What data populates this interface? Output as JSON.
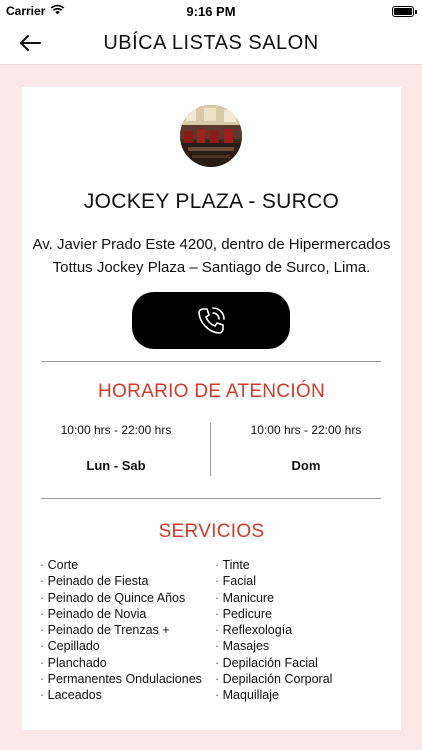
{
  "status_bar": {
    "carrier": "Carrier",
    "time": "9:16 PM"
  },
  "nav": {
    "title": "UBÍCA LISTAS SALON",
    "back_icon": "arrow-left-icon"
  },
  "store": {
    "name": "JOCKEY PLAZA - SURCO",
    "address_line1": "Av. Javier Prado Este 4200, dentro de Hipermercados",
    "address_line2": "Tottus Jockey Plaza – Santiago de Surco, Lima.",
    "call_icon": "phone-call-icon"
  },
  "hours": {
    "title": "HORARIO DE ATENCIÓN",
    "columns": [
      {
        "time": "10:00 hrs - 22:00 hrs",
        "days": "Lun - Sab"
      },
      {
        "time": "10:00 hrs - 22:00 hrs",
        "days": "Dom"
      }
    ]
  },
  "services": {
    "title": "SERVICIOS",
    "left": [
      "Corte",
      "Peinado de Fiesta",
      "Peinado de Quince Años",
      "Peinado de Novia",
      "Peinado de Trenzas +",
      "Cepillado",
      "Planchado",
      "Permanentes Ondulaciones",
      "Laceados"
    ],
    "right": [
      "Tinte",
      "Facial",
      "Manicure",
      "Pedicure",
      "Reflexología",
      "Masajes",
      "Depilación Facial",
      "Depilación Corporal",
      "Maquillaje"
    ]
  },
  "colors": {
    "accent": "#d23a2a",
    "background": "#fbe9e9",
    "button": "#000000"
  }
}
